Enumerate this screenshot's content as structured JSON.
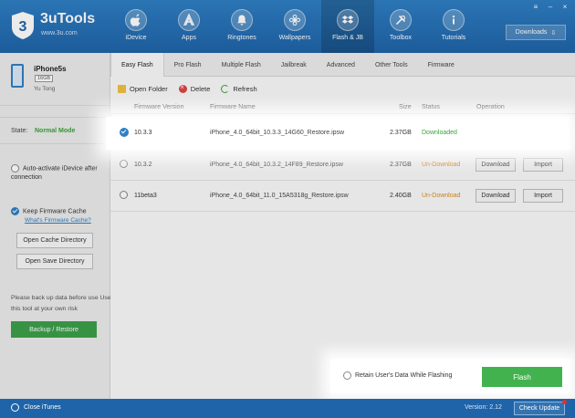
{
  "app": {
    "name": "3uTools",
    "site": "www.3u.com"
  },
  "nav": [
    {
      "label": "iDevice",
      "icon": "apple-icon"
    },
    {
      "label": "Apps",
      "icon": "apps-icon"
    },
    {
      "label": "Ringtones",
      "icon": "bell-icon"
    },
    {
      "label": "Wallpapers",
      "icon": "flower-icon"
    },
    {
      "label": "Flash & JB",
      "icon": "dropbox-icon",
      "active": true
    },
    {
      "label": "Toolbox",
      "icon": "tools-icon"
    },
    {
      "label": "Tutorials",
      "icon": "info-icon"
    }
  ],
  "downloads_label": "Downloads",
  "device": {
    "name": "iPhone5s",
    "capacity": "16GB",
    "owner": "Yu Tong"
  },
  "state": {
    "label": "State:",
    "value": "Normal Mode"
  },
  "options": {
    "auto_activate": "Auto-activate iDevice after connection",
    "keep_cache": "Keep Firmware Cache",
    "cache_link": "What's Firmware Cache?",
    "open_cache": "Open Cache Directory",
    "open_save": "Open Save Directory"
  },
  "backup": {
    "note": "Please back up data before use Use this tool at your own risk",
    "button": "Backup / Restore"
  },
  "tabs": [
    "Easy Flash",
    "Pro Flash",
    "Multiple Flash",
    "Jailbreak",
    "Advanced",
    "Other Tools",
    "Firmware"
  ],
  "toolbar": {
    "open_folder": "Open Folder",
    "delete": "Delete",
    "refresh": "Refresh"
  },
  "table": {
    "headers": [
      "Firmware Version",
      "Firmware Name",
      "Size",
      "Status",
      "Operation"
    ],
    "rows": [
      {
        "version": "10.3.3",
        "name": "iPhone_4.0_64bit_10.3.3_14G60_Restore.ipsw",
        "size": "2.37GB",
        "status": "Downloaded",
        "selected": true
      },
      {
        "version": "10.3.2",
        "name": "iPhone_4.0_64bit_10.3.2_14F89_Restore.ipsw",
        "size": "2.37GB",
        "status": "Un-Download",
        "download": "Download",
        "import": "Import"
      },
      {
        "version": "11beta3",
        "name": "iPhone_4.0_64bit_11.0_15A5318g_Restore.ipsw",
        "size": "2.40GB",
        "status": "Un-Download",
        "download": "Download",
        "import": "Import"
      }
    ]
  },
  "retain_label": "Retain User's Data While Flashing",
  "flash_label": "Flash",
  "status": {
    "close_itunes": "Close iTunes",
    "version": "Version: 2.12",
    "check_update": "Check Update"
  },
  "colors": {
    "brand_blue": "#1f64a8",
    "green": "#41b24e",
    "orange": "#e08a1a"
  }
}
